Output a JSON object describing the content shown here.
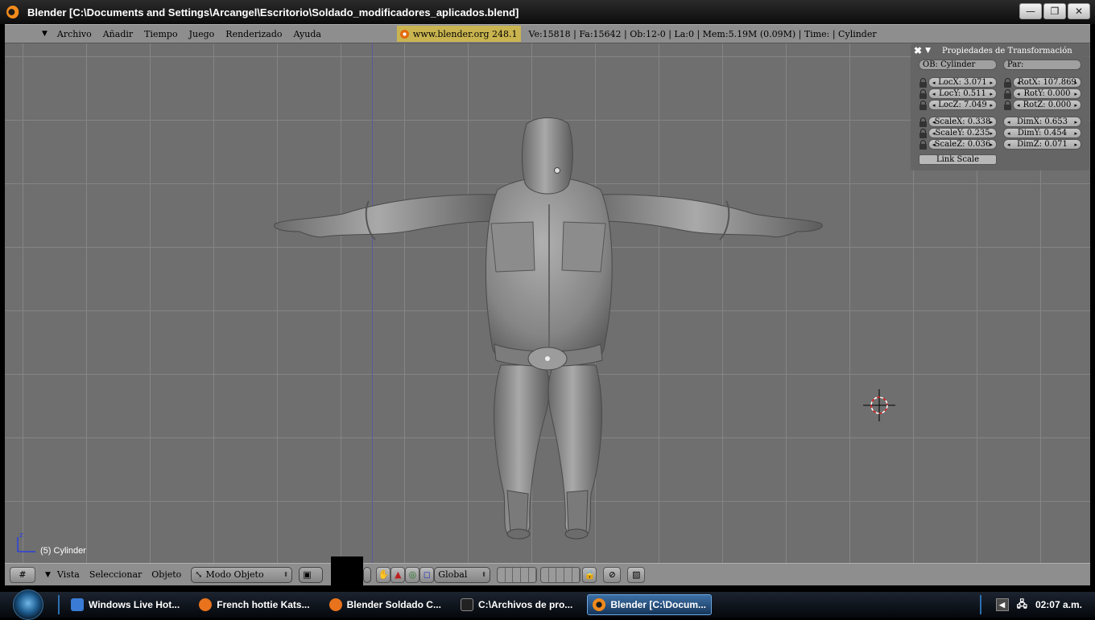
{
  "window": {
    "title": "Blender [C:\\Documents and Settings\\Arcangel\\Escritorio\\Soldado_modificadores_aplicados.blend]",
    "controls": {
      "minimize": "—",
      "maximize": "❐",
      "close": "✕"
    }
  },
  "header": {
    "menus": [
      "Archivo",
      "Añadir",
      "Tiempo",
      "Juego",
      "Renderizado",
      "Ayuda"
    ],
    "url": "www.blender.org 248.1",
    "stats": "Ve:15818 | Fa:15642 | Ob:12-0 | La:0  | Mem:5.19M (0.09M)  | Time:  | Cylinder"
  },
  "transform_panel": {
    "title": "Propiedades de Transformación",
    "ob_field": "OB: Cylinder",
    "par_field": "Par:",
    "loc": [
      "LocX: 3.071",
      "LocY: 0.511",
      "LocZ: 7.049"
    ],
    "rot": [
      "RotX: 107.869",
      "RotY: 0.000",
      "RotZ: 0.000"
    ],
    "scale": [
      "ScaleX: 0.338",
      "ScaleY: 0.235",
      "ScaleZ: 0.036"
    ],
    "dim": [
      "DimX: 0.653",
      "DimY: 0.454",
      "DimZ: 0.071"
    ],
    "link_scale": "Link Scale"
  },
  "viewport": {
    "object_label": "(5) Cylinder",
    "axis_label": "z"
  },
  "footer": {
    "menus": [
      "Vista",
      "Seleccionar",
      "Objeto"
    ],
    "mode": "Modo Objeto",
    "orientation": "Global"
  },
  "taskbar": {
    "tasks": [
      {
        "label": "Windows Live Hot...",
        "icon": "document-icon",
        "color": "#3a7bd5"
      },
      {
        "label": "French hottie Kats...",
        "icon": "firefox-icon",
        "color": "#e8731c"
      },
      {
        "label": "Blender Soldado C...",
        "icon": "firefox-icon",
        "color": "#e8731c"
      },
      {
        "label": "C:\\Archivos de pro...",
        "icon": "cmd-icon",
        "color": "#222222"
      },
      {
        "label": "Blender [C:\\Docum...",
        "icon": "blender-icon",
        "color": "#f08a1c",
        "active": true
      }
    ],
    "clock": "02:07 a.m."
  },
  "colors": {
    "viewport_bg": "#6f6f6f",
    "header_bg": "#8e8e8e",
    "url_bg": "#c9b450",
    "taskbar_active": "#3c6fa6"
  }
}
